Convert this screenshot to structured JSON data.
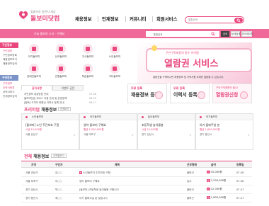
{
  "header": {
    "tagline": "맞춤으로 동반자 세상",
    "brand": "돌보미닷컴",
    "nav": [
      "채용정보",
      "인재정보",
      "커뮤니티",
      "회원서비스"
    ],
    "search_select": "통합검색"
  },
  "bar": {
    "notice": "오늘 돌보미 소식 · 구해요",
    "search_category": "통합검색",
    "btn1": "검색",
    "btn2": "상세검색",
    "btn3": "마이페이지"
  },
  "sidebar": {
    "tab1": "구인정보",
    "items1": [
      "구인정보",
      "구인정보등록",
      "채용정보보기",
      "채용정보검색"
    ],
    "tab2": "구직정보",
    "items2": [
      "구직정보",
      "이력서등록",
      "이력서보기",
      "인재정보검색"
    ]
  },
  "categories": [
    "아기돌보미",
    "산모돌보미",
    "가사돌보미",
    "노인돌보미",
    "장애인돌보미",
    "간병돌보미",
    "학습돌보미",
    "기타돌보미"
  ],
  "banner": {
    "sub": "구인구직회원의 필수 아이템",
    "big": "열람권 서비스",
    "desc": "열람권을 구매하시면 채용정보 및 이력서를 무제한 열람할 수 있습니다."
  },
  "notice": {
    "tabs": [
      "공지사항",
      "이벤트 공문"
    ],
    "items": [
      {
        "text": "개인정보 취급방침 안내",
        "date": "07-08"
      },
      {
        "text": "돌보미닷컴 서비스 이용 안내 및 운영정책",
        "date": "06-30"
      },
      {
        "text": "[필독] 구직자 회원님 이력서 등록 안내",
        "date": "06-17"
      }
    ]
  },
  "promos": [
    {
      "t1": "무료 등록",
      "t2": "채용정보 등록"
    },
    {
      "t1": "무료 등록",
      "t2": "이력서 등록"
    },
    {
      "t1": "구인구직회원의 필수!",
      "t2": "열람권신청"
    }
  ],
  "premium": {
    "heading_mark": "프리미엄",
    "heading": "채용정보",
    "more": "전체보기",
    "cards": [
      {
        "cat": "노인돌보미",
        "title": "[돌보미] 노인 주간보호 구함",
        "pay": "시급 10,000원",
        "loc": "서울 강남구"
      },
      {
        "cat": "아기돌보미",
        "title": "영아 돌보미 구해요",
        "pay": "월급 1,500,000원",
        "loc": "서울 마포구"
      },
      {
        "cat": "놀이돌보미",
        "title": "초등학생 놀이돌봄",
        "pay": "시급 12,000원",
        "loc": "경기 성남시"
      },
      {
        "cat": "아기돌보미",
        "title": "아기 돌봐주실 분",
        "pay": "월급 1,800,000원",
        "loc": "경기 용인시"
      }
    ]
  },
  "jobs": {
    "heading_mark": "전체",
    "heading": "채용정보",
    "filter": "지역별보기",
    "columns": [
      "지역",
      "구인자",
      "제목",
      "근무형태",
      "급여",
      "등록일"
    ],
    "rows": [
      {
        "area": "서울 강남구",
        "name": "김○○",
        "title": "노인돌보미 주간보호 구함",
        "type": "출퇴근",
        "pay": "10,000원",
        "date": "07-08"
      },
      {
        "area": "서울 마포구",
        "name": "이○○",
        "title": "영아 돌보미 구해요",
        "type": "입주",
        "pay": "1,500,000원",
        "date": "07-08"
      },
      {
        "area": "경기 성남시",
        "name": "박○○",
        "title": "[돌보미] 초등학생 놀이돌봄 구합니다",
        "type": "출퇴근",
        "pay": "12,000원",
        "date": "07-07"
      },
      {
        "area": "경기 용인시",
        "name": "최○○",
        "title": "아기 돌봐주실 분 찾습니다",
        "type": "출퇴근",
        "pay": "1,800,000원",
        "date": "07-07"
      }
    ]
  }
}
